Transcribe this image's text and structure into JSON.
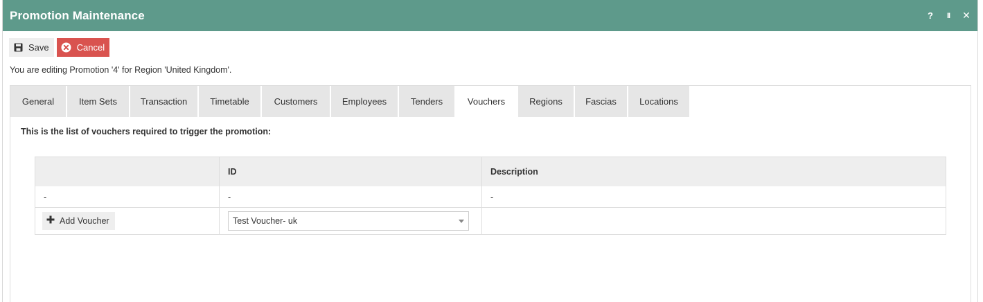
{
  "window": {
    "title": "Promotion Maintenance",
    "controls": {
      "help": "?",
      "pause": "II",
      "close": "✕"
    }
  },
  "toolbar": {
    "save_label": "Save",
    "cancel_label": "Cancel"
  },
  "info_text": "You are editing Promotion '4' for Region 'United Kingdom'.",
  "tabs": [
    {
      "label": "General",
      "active": false
    },
    {
      "label": "Item Sets",
      "active": false
    },
    {
      "label": "Transaction",
      "active": false
    },
    {
      "label": "Timetable",
      "active": false
    },
    {
      "label": "Customers",
      "active": false
    },
    {
      "label": "Employees",
      "active": false
    },
    {
      "label": "Tenders",
      "active": false
    },
    {
      "label": "Vouchers",
      "active": true
    },
    {
      "label": "Regions",
      "active": false
    },
    {
      "label": "Fascias",
      "active": false
    },
    {
      "label": "Locations",
      "active": false
    }
  ],
  "vouchers": {
    "heading": "This is the list of vouchers required to trigger the promotion:",
    "columns": [
      "",
      "ID",
      "Description"
    ],
    "rows": [
      [
        "-",
        "-",
        "-"
      ]
    ],
    "add_button_label": "Add Voucher",
    "selected_voucher": "Test Voucher- uk",
    "new_description": ""
  },
  "colors": {
    "titlebar": "#5e9a8b",
    "cancel": "#d9534f",
    "tab_inactive": "#e6e6e6"
  }
}
